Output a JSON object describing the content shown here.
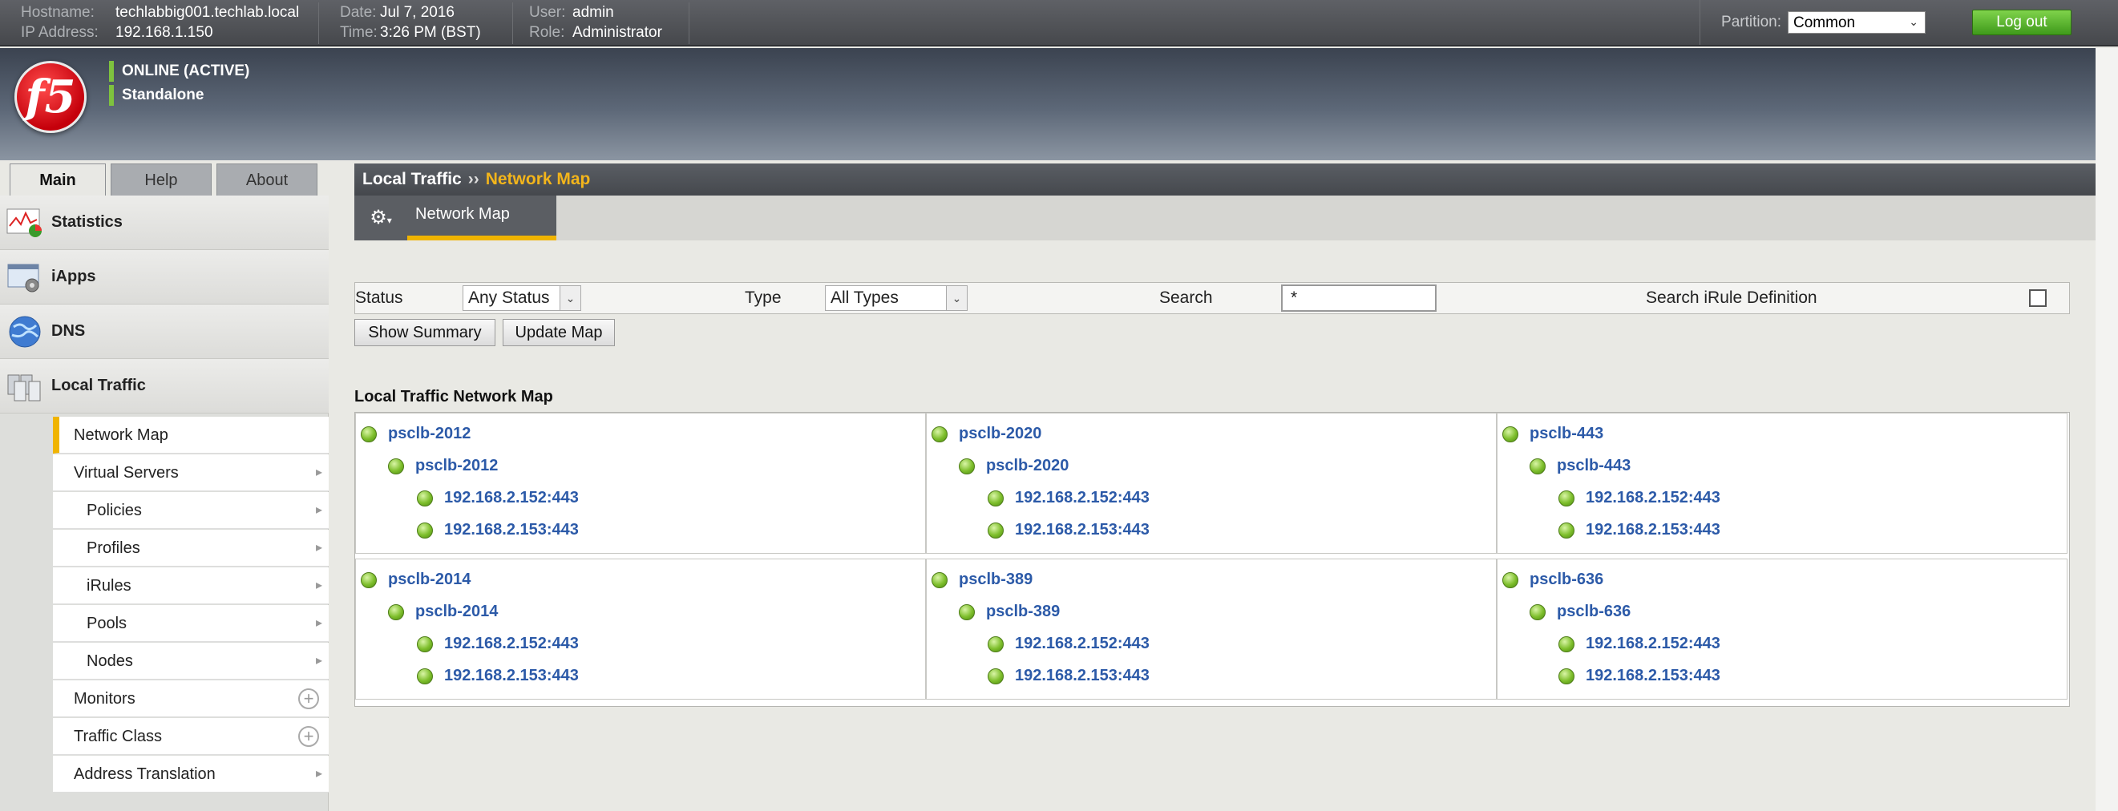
{
  "top_bar": {
    "hostname_label": "Hostname:",
    "hostname": "techlabbig001.techlab.local",
    "ip_label": "IP Address:",
    "ip": "192.168.1.150",
    "date_label": "Date:",
    "date": "Jul 7, 2016",
    "time_label": "Time:",
    "time": "3:26 PM (BST)",
    "user_label": "User:",
    "user": "admin",
    "role_label": "Role:",
    "role": "Administrator",
    "partition_label": "Partition:",
    "partition_value": "Common",
    "logout_label": "Log out"
  },
  "header": {
    "logo_text": "f5",
    "status_online": "ONLINE (ACTIVE)",
    "status_mode": "Standalone",
    "status_color": "#7ec23e"
  },
  "tabs": [
    {
      "label": "Main",
      "active": true
    },
    {
      "label": "Help",
      "active": false
    },
    {
      "label": "About",
      "active": false
    }
  ],
  "sidebar": {
    "items": [
      {
        "label": "Statistics",
        "icon": "statistics-icon"
      },
      {
        "label": "iApps",
        "icon": "iapps-icon"
      },
      {
        "label": "DNS",
        "icon": "dns-globe-icon"
      },
      {
        "label": "Local Traffic",
        "icon": "local-traffic-icon"
      }
    ],
    "local_traffic_submenu": [
      {
        "label": "Network Map",
        "active": true
      },
      {
        "label": "Virtual Servers"
      },
      {
        "label": "Policies"
      },
      {
        "label": "Profiles"
      },
      {
        "label": "iRules"
      },
      {
        "label": "Pools"
      },
      {
        "label": "Nodes"
      },
      {
        "label": "Monitors"
      },
      {
        "label": "Traffic Class"
      },
      {
        "label": "Address Translation"
      }
    ]
  },
  "breadcrumb": {
    "parent": "Local Traffic",
    "separator": "››",
    "current": "Network Map"
  },
  "subtab": {
    "label": "Network Map",
    "accent_color": "#f0b400"
  },
  "filter": {
    "status_label": "Status",
    "status_value": "Any Status",
    "type_label": "Type",
    "type_value": "All Types",
    "search_label": "Search",
    "search_value": "*",
    "irule_label": "Search iRule Definition"
  },
  "buttons": {
    "show_summary": "Show Summary",
    "update_map": "Update Map"
  },
  "network_map": {
    "title": "Local Traffic Network Map",
    "cells": [
      {
        "virtual": "psclb-2012",
        "pool": "psclb-2012",
        "members": [
          "192.168.2.152:443",
          "192.168.2.153:443"
        ]
      },
      {
        "virtual": "psclb-2020",
        "pool": "psclb-2020",
        "members": [
          "192.168.2.152:443",
          "192.168.2.153:443"
        ]
      },
      {
        "virtual": "psclb-443",
        "pool": "psclb-443",
        "members": [
          "192.168.2.152:443",
          "192.168.2.153:443"
        ]
      },
      {
        "virtual": "psclb-2014",
        "pool": "psclb-2014",
        "members": [
          "192.168.2.152:443",
          "192.168.2.153:443"
        ]
      },
      {
        "virtual": "psclb-389",
        "pool": "psclb-389",
        "members": [
          "192.168.2.152:443",
          "192.168.2.153:443"
        ]
      },
      {
        "virtual": "psclb-636",
        "pool": "psclb-636",
        "members": [
          "192.168.2.152:443",
          "192.168.2.153:443"
        ]
      }
    ]
  }
}
